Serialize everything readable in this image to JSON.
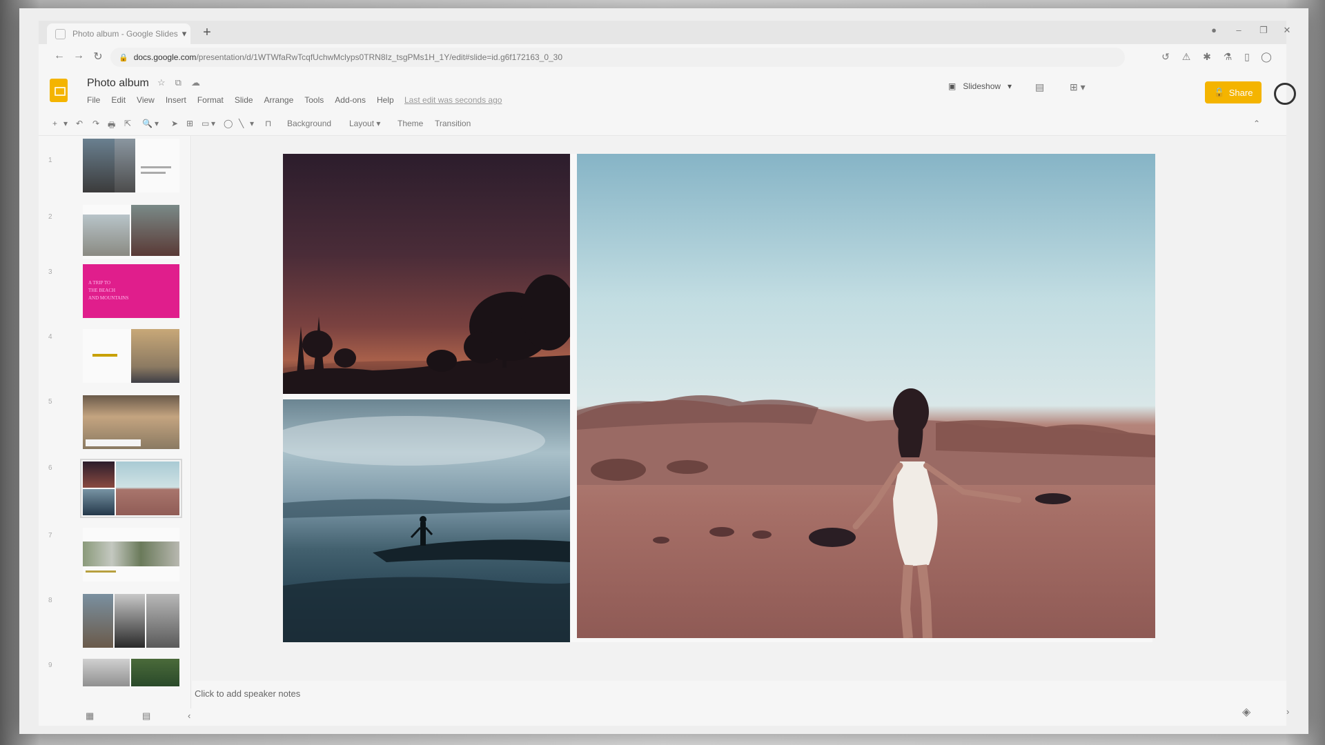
{
  "tab": {
    "title": "Photo album - Google Slides",
    "close": "▾"
  },
  "new_tab": "+",
  "window": {
    "record": "●",
    "minimize": "–",
    "restore": "❐",
    "close": "✕"
  },
  "nav": {
    "back": "←",
    "forward": "→",
    "reload": "↻"
  },
  "url": {
    "host": "docs.google.com",
    "path": "/presentation/d/1WTWfaRwTcqfUchwMclyps0TRN8Iz_tsgPMs1H_1Y/edit#slide=id.g6f172163_0_30"
  },
  "extensions": [
    "↺",
    "⚠",
    "✱",
    "⚗",
    "▯",
    "◯"
  ],
  "doc": {
    "title": "Photo album",
    "star": "☆",
    "move": "⧉",
    "cloud": "☁"
  },
  "menu": [
    "File",
    "Edit",
    "View",
    "Insert",
    "Format",
    "Slide",
    "Arrange",
    "Tools",
    "Add-ons",
    "Help"
  ],
  "last_edit": "Last edit was seconds ago",
  "header": {
    "comments": "▤",
    "present_icon": "⊞ ▾",
    "slideshow": "Slideshow",
    "slideshow_arrow": "▾",
    "share": "Share",
    "share_icon": "🔒"
  },
  "toolbar": {
    "items": [
      "+",
      "▾",
      "↶",
      "↷",
      "🖶",
      "⇱",
      "🔍",
      "▾",
      "➤",
      "⊞",
      "▭",
      "▾",
      "◯",
      "╲",
      "▾",
      "⊓"
    ],
    "background": "Background",
    "layout": "Layout ▾",
    "theme": "Theme",
    "transition": "Transition",
    "collapse": "⌃"
  },
  "slide_numbers": [
    "1",
    "2",
    "3",
    "4",
    "5",
    "6",
    "7",
    "8",
    "9"
  ],
  "thumb3_text": [
    "A TRIP TO",
    "THE BEACH",
    "AND MOUNTAINS"
  ],
  "speaker_notes": "Click to add speaker notes",
  "bottom": {
    "grid": "▦",
    "list": "▤",
    "arrow": "‹",
    "explore": "◈",
    "chevron": "›"
  },
  "right_panel": {
    "calendar": "▦",
    "keep": "◼",
    "tasks": "✔",
    "contacts": "●",
    "add": "+"
  }
}
